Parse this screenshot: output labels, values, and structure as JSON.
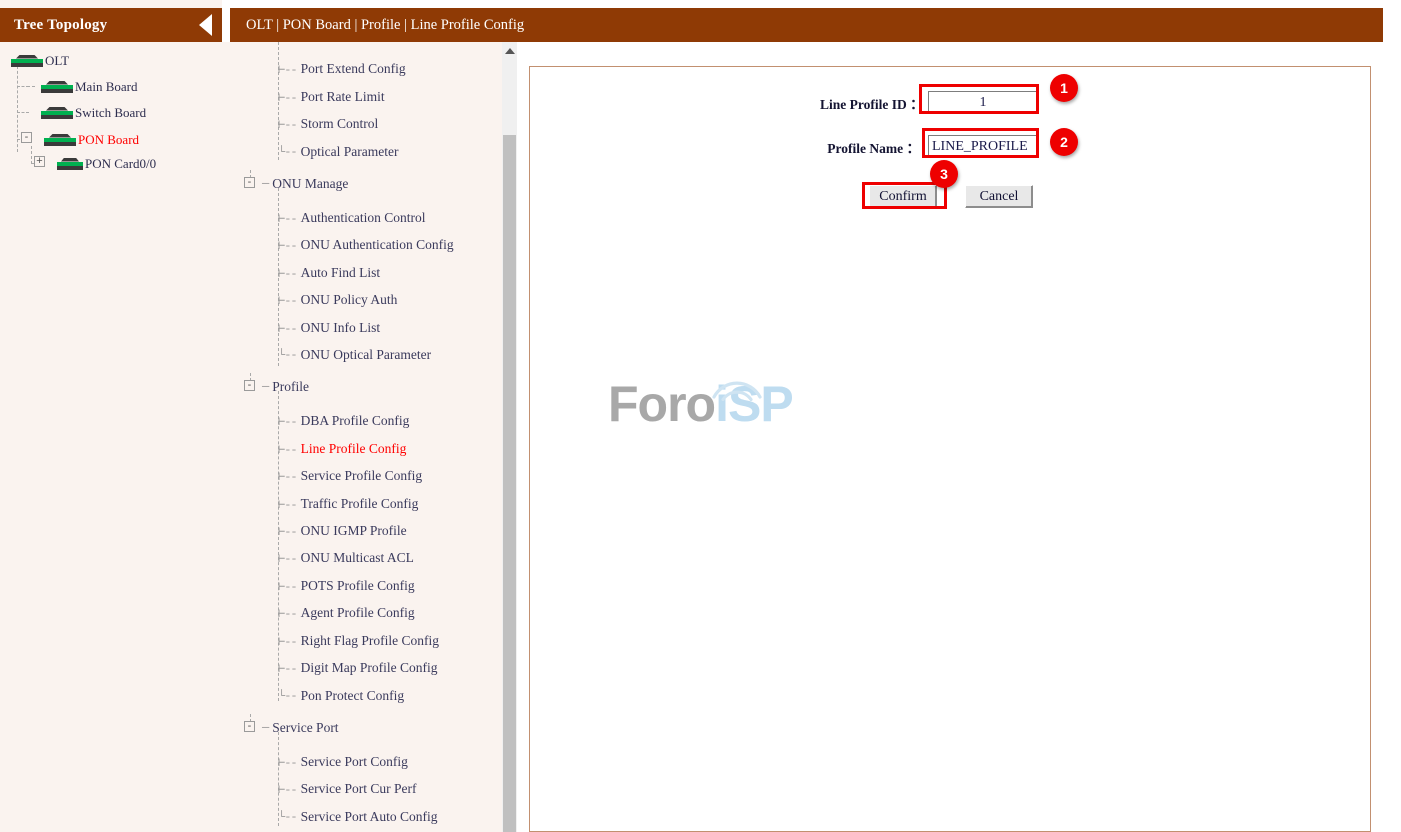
{
  "tree": {
    "title": "Tree Topology",
    "collapse_icon": "triangle-left-icon",
    "nodes": [
      {
        "label": "OLT",
        "icon": "device-board-icon",
        "toggle": "",
        "selected": false
      },
      {
        "label": "Main Board",
        "icon": "device-board-icon",
        "toggle": "",
        "selected": false
      },
      {
        "label": "Switch Board",
        "icon": "device-board-icon",
        "toggle": "",
        "selected": false
      },
      {
        "label": "PON Board",
        "icon": "device-board-icon",
        "toggle": "-",
        "selected": true
      },
      {
        "label": "PON Card0/0",
        "icon": "device-board-icon",
        "toggle": "+",
        "selected": false
      }
    ]
  },
  "header": {
    "breadcrumb": "OLT | PON Board | Profile | Line Profile Config"
  },
  "menu": {
    "items": [
      {
        "label": "Port Extend Config",
        "type": "leaf",
        "selected": false
      },
      {
        "label": "Port Rate Limit",
        "type": "leaf",
        "selected": false
      },
      {
        "label": "Storm Control",
        "type": "leaf",
        "selected": false
      },
      {
        "label": "Optical Parameter",
        "type": "leaf",
        "selected": false
      },
      {
        "label": "ONU Manage",
        "type": "group",
        "selected": false,
        "toggle": "-"
      },
      {
        "label": "Authentication Control",
        "type": "leaf",
        "selected": false
      },
      {
        "label": "ONU Authentication Config",
        "type": "leaf",
        "selected": false
      },
      {
        "label": "Auto Find List",
        "type": "leaf",
        "selected": false
      },
      {
        "label": "ONU Policy Auth",
        "type": "leaf",
        "selected": false
      },
      {
        "label": "ONU Info List",
        "type": "leaf",
        "selected": false
      },
      {
        "label": "ONU Optical Parameter",
        "type": "leaf",
        "selected": false
      },
      {
        "label": "Profile",
        "type": "group",
        "selected": false,
        "toggle": "-"
      },
      {
        "label": "DBA Profile Config",
        "type": "leaf",
        "selected": false
      },
      {
        "label": "Line Profile Config",
        "type": "leaf",
        "selected": true
      },
      {
        "label": "Service Profile Config",
        "type": "leaf",
        "selected": false
      },
      {
        "label": "Traffic Profile Config",
        "type": "leaf",
        "selected": false
      },
      {
        "label": "ONU IGMP Profile",
        "type": "leaf",
        "selected": false
      },
      {
        "label": "ONU Multicast ACL",
        "type": "leaf",
        "selected": false
      },
      {
        "label": "POTS Profile Config",
        "type": "leaf",
        "selected": false
      },
      {
        "label": "Agent Profile Config",
        "type": "leaf",
        "selected": false
      },
      {
        "label": "Right Flag Profile Config",
        "type": "leaf",
        "selected": false
      },
      {
        "label": "Digit Map Profile Config",
        "type": "leaf",
        "selected": false
      },
      {
        "label": "Pon Protect Config",
        "type": "leaf",
        "selected": false
      },
      {
        "label": "Service Port",
        "type": "group",
        "selected": false,
        "toggle": "-"
      },
      {
        "label": "Service Port Config",
        "type": "leaf",
        "selected": false
      },
      {
        "label": "Service Port Cur Perf",
        "type": "leaf",
        "selected": false
      },
      {
        "label": "Service Port Auto Config",
        "type": "leaf",
        "selected": false
      }
    ],
    "scroll_up_icon": "triangle-up-icon"
  },
  "form": {
    "profile_id_label": "Line Profile ID ：",
    "profile_id_value": "1",
    "profile_name_label": "Profile Name ：",
    "profile_name_value": "LINE_PROFILE",
    "confirm_label": "Confirm",
    "cancel_label": "Cancel"
  },
  "annotations": [
    {
      "number": "1"
    },
    {
      "number": "2"
    },
    {
      "number": "3"
    }
  ],
  "watermark": {
    "text_primary": "Foro",
    "text_secondary": "iSP"
  },
  "colors": {
    "header_brown": "#8f3a05",
    "panel_cream": "#faf3ef",
    "selected_red": "#ff0000",
    "annotation_red": "#ee0000",
    "content_border": "#c29070",
    "led_green": "#00b050"
  }
}
